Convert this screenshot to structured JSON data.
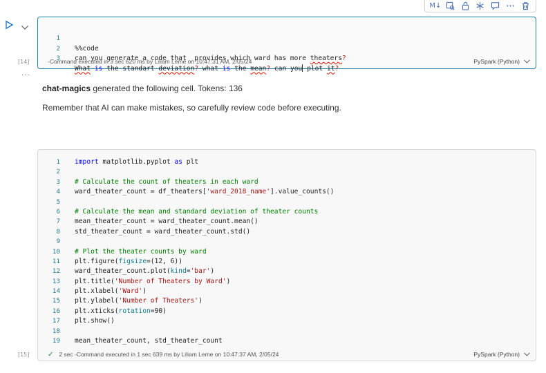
{
  "toolbar": {
    "markdown_label": "M↓",
    "icons": [
      "markdown-icon",
      "preview-icon",
      "lock-icon",
      "asterisk-icon",
      "comment-icon",
      "more-icon",
      "delete-icon"
    ]
  },
  "cell1": {
    "exec_count": "[14]",
    "lines": [
      {
        "n": "1",
        "t": "%%code"
      },
      {
        "n": "2",
        "t": "can you generate a code that  provides which ward has more theaters?"
      },
      {
        "n": "3",
        "t": "What is the standart deviation? what is the mean? can you plot it?"
      }
    ],
    "status": "-Command executed in 3 sec 620 ms by Liliam Leme on 10:47:31 AM, 2/05/24",
    "language": "PySpark (Python)"
  },
  "more_dots": "···",
  "assistant": {
    "name": "chat-magics",
    "generated_text": "generated the following cell. Tokens: 136",
    "warning": "Remember that AI can make mistakes, so carefully review code before executing."
  },
  "cell2": {
    "exec_count": "[15]",
    "lines": [
      {
        "n": "1",
        "t": "import matplotlib.pyplot as plt"
      },
      {
        "n": "2",
        "t": ""
      },
      {
        "n": "3",
        "t": "# Calculate the count of theaters in each ward"
      },
      {
        "n": "4",
        "t": "ward_theater_count = df_theaters['ward_2018_name'].value_counts()"
      },
      {
        "n": "5",
        "t": ""
      },
      {
        "n": "6",
        "t": "# Calculate the mean and standard deviation of theater counts"
      },
      {
        "n": "7",
        "t": "mean_theater_count = ward_theater_count.mean()"
      },
      {
        "n": "8",
        "t": "std_theater_count = ward_theater_count.std()"
      },
      {
        "n": "9",
        "t": ""
      },
      {
        "n": "10",
        "t": "# Plot the theater counts by ward"
      },
      {
        "n": "11",
        "t": "plt.figure(figsize=(12, 6))"
      },
      {
        "n": "12",
        "t": "ward_theater_count.plot(kind='bar')"
      },
      {
        "n": "13",
        "t": "plt.title('Number of Theaters by Ward')"
      },
      {
        "n": "14",
        "t": "plt.xlabel('Ward')"
      },
      {
        "n": "15",
        "t": "plt.ylabel('Number of Theaters')"
      },
      {
        "n": "16",
        "t": "plt.xticks(rotation=90)"
      },
      {
        "n": "17",
        "t": "plt.show()"
      },
      {
        "n": "18",
        "t": ""
      },
      {
        "n": "19",
        "t": "mean_theater_count, std_theater_count"
      }
    ],
    "status_time": "2 sec",
    "status": "-Command executed in 1 sec 639 ms by Liliam Leme on 10:47:37 AM, 2/05/24",
    "language": "PySpark (Python)"
  },
  "colors": {
    "accent": "#0f6cbd",
    "cell_border_active": "#1b82a8",
    "keyword": "#0000ff",
    "string": "#a31515",
    "comment": "#008000",
    "success": "#2e8b3c"
  }
}
